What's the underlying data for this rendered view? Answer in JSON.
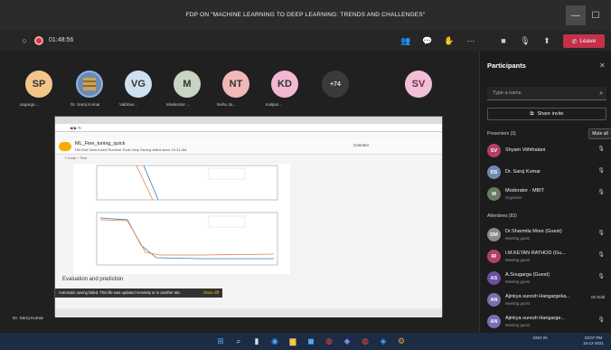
{
  "window": {
    "title": "FDP ON \"MACHINE LEARNING TO DEEP LEARNING: TRENDS AND CHALLENGES\"",
    "minimize_icon": "minimize-icon",
    "maximize_icon": "maximize-icon"
  },
  "toolbar": {
    "timer": "01:48:56",
    "leave_label": "Leave",
    "colors": {
      "leave": "#c4314b",
      "record": "#d13438"
    }
  },
  "gallery": {
    "tiles": [
      {
        "initials": "SP",
        "name": "sagarga ...",
        "color": "#f4c58a"
      },
      {
        "initials": "",
        "name": "Dr. Saroj Kumar",
        "color": "#6d8bb3"
      },
      {
        "initials": "VG",
        "name": "Vaibhav...",
        "color": "#cfe0f0"
      },
      {
        "initials": "M",
        "name": "Moderator ...",
        "color": "#c9d4c2"
      },
      {
        "initials": "NT",
        "name": "Neha Ja...",
        "color": "#f2b8b8"
      },
      {
        "initials": "KD",
        "name": "Kalpan...",
        "color": "#f2b8d2"
      },
      {
        "initials": "+74",
        "name": "",
        "color": "#3a3a3a"
      },
      {
        "initials": "SV",
        "name": "",
        "color": "#f0c0d6"
      }
    ]
  },
  "shared": {
    "notebook_title": "ML_Fine_tuning_quick",
    "menu": "File  Edit  View  Insert  Runtime  Tools  Help  Saving failed since 10:31 AM",
    "connect": "Connect",
    "section": "Evaluation and prediction",
    "notification": "Automatic saving failed. This file was updated remotely or in another tab.",
    "notification_action": "Show diff",
    "presenter_label": "Dr. Saroj Kumar"
  },
  "panel": {
    "title": "Participants",
    "search_placeholder": "Type a name",
    "share_invite": "Share invite",
    "presenters_header": "Presenters (3)",
    "mute_all": "Mute all",
    "attendees_header": "Attendees (83)",
    "presenters": [
      {
        "initials": "SV",
        "name": "Shyam Viththalani",
        "sub": "",
        "color": "#b43e6b"
      },
      {
        "initials": "DS",
        "name": "Dr. Saroj Kumar",
        "sub": "",
        "color": "#6d8bb3"
      },
      {
        "initials": "M",
        "name": "Moderator - MBIT",
        "sub": "Organizer",
        "color": "#6b7a66"
      }
    ],
    "attendees": [
      {
        "initials": "DM",
        "name": "Dr.Sharmila More (Guest)",
        "sub": "Meeting guest",
        "color": "#8a8a8a",
        "status": ""
      },
      {
        "initials": "IR",
        "name": "I.M.KETAN RATHOD (Gu...",
        "sub": "Meeting guest",
        "color": "#b43e6b",
        "status": ""
      },
      {
        "initials": "AS",
        "name": "A.Sougarga (Guest)",
        "sub": "Meeting guest",
        "color": "#6a4fa0",
        "status": ""
      },
      {
        "initials": "AN",
        "name": "Ajinkya suresh Hangargeka...",
        "sub": "Meeting guest",
        "color": "#7b6db0",
        "status": "On hold"
      },
      {
        "initials": "AN",
        "name": "Ajinkya suresh Hangarge...",
        "sub": "Meeting guest",
        "color": "#7b6db0",
        "status": ""
      }
    ]
  },
  "taskbar": {
    "lang": "ENG IN",
    "time": "03:07 PM",
    "date": "15-12-2021"
  }
}
